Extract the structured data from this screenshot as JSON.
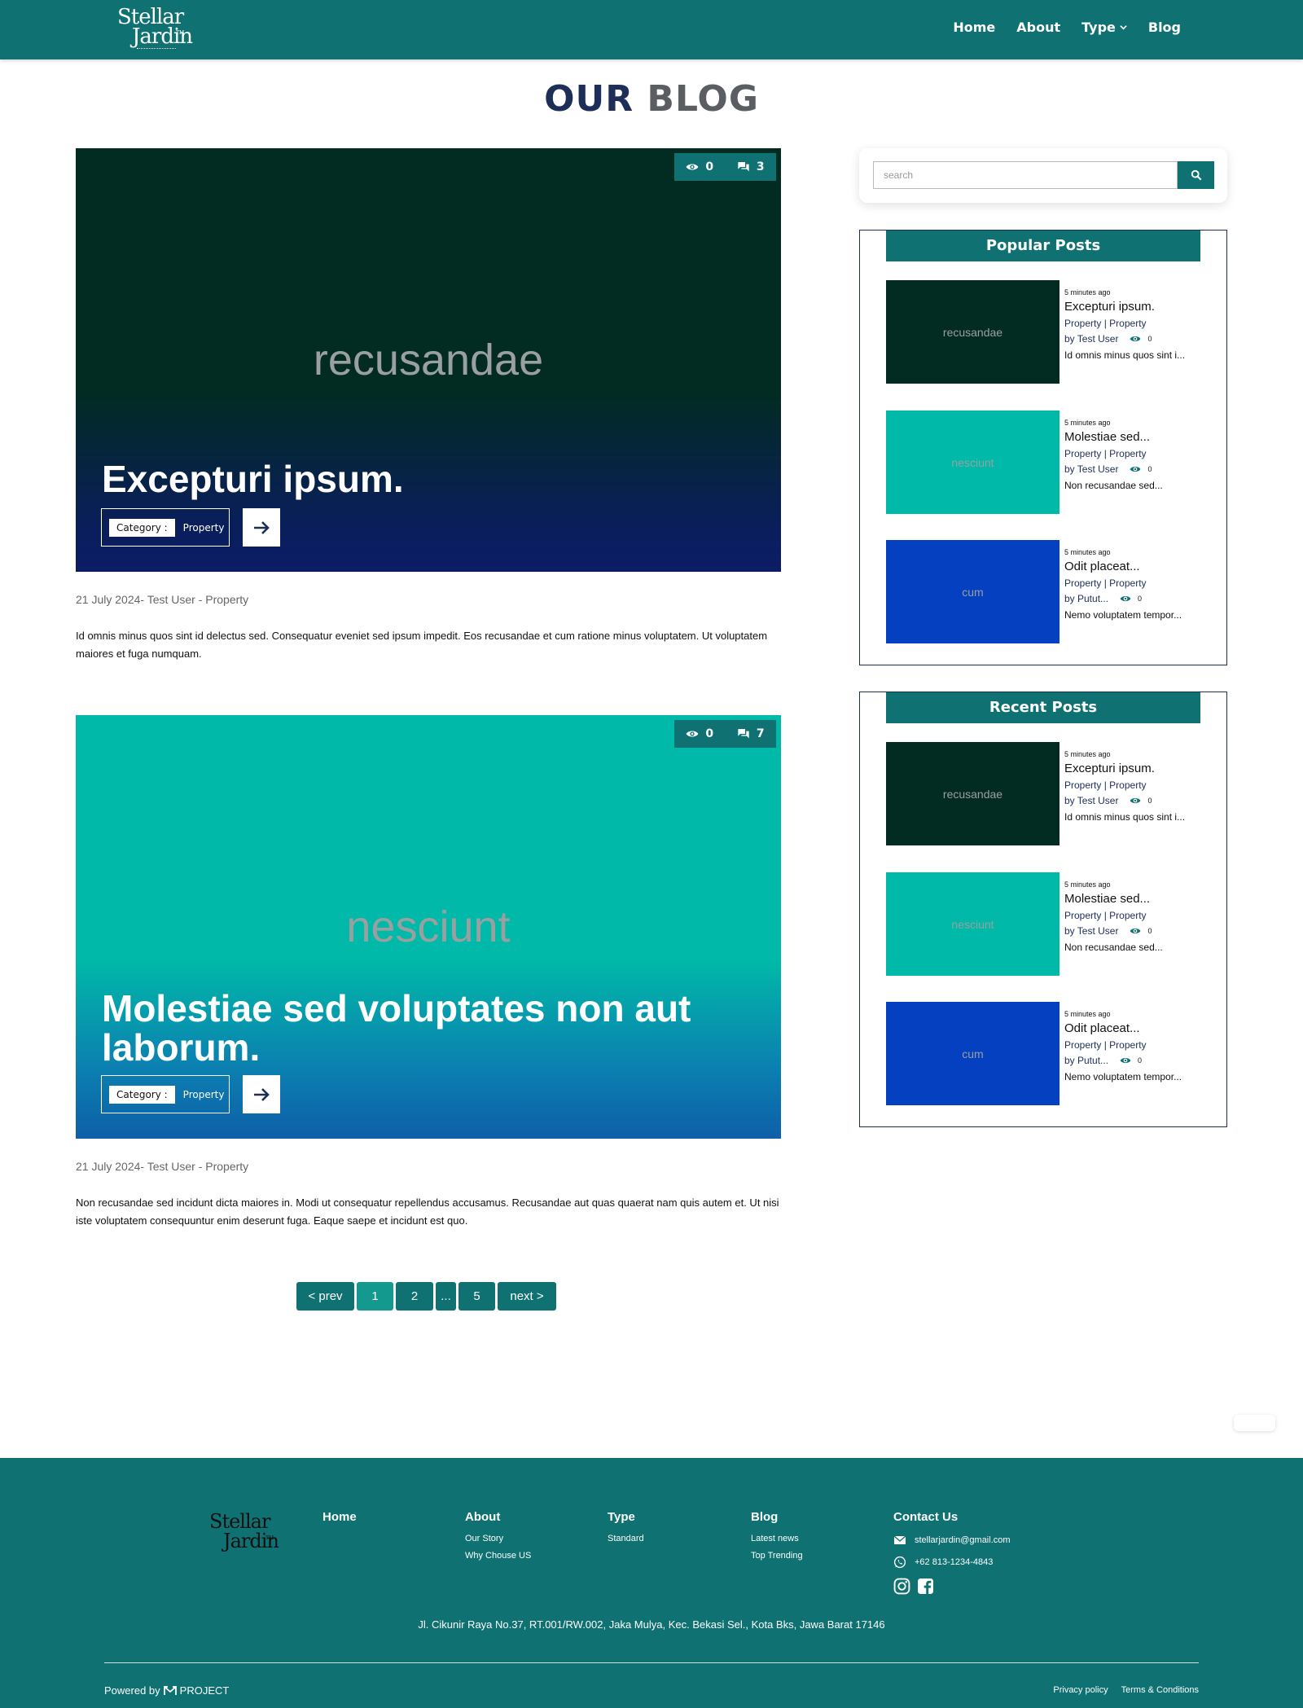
{
  "brand": {
    "logo_line1": "Stellar",
    "logo_line2": "Jardin",
    "logo_mark": "TM"
  },
  "nav": {
    "home": "Home",
    "about": "About",
    "type": "Type",
    "blog": "Blog"
  },
  "page": {
    "title_part1": "OUR",
    "title_part2": "BLOG"
  },
  "posts": [
    {
      "image_label": "recusandae",
      "image_color": "#022b22",
      "views": "0",
      "comments": "3",
      "title": "Excepturi ipsum.",
      "category_label": "Category :",
      "category": "Property",
      "meta": "21 July 2024- Test User - Property",
      "excerpt": "Id omnis minus quos sint id delectus sed. Consequatur eveniet sed ipsum impedit. Eos recusandae et cum ratione minus voluptatem. Ut voluptatem maiores et fuga numquam."
    },
    {
      "image_label": "nesciunt",
      "image_color": "#00b9a8",
      "views": "0",
      "comments": "7",
      "title": "Molestiae sed voluptates non aut laborum.",
      "category_label": "Category :",
      "category": "Property",
      "meta": "21 July 2024- Test User - Property",
      "excerpt": "Non recusandae sed incidunt dicta maiores in. Modi ut consequatur repellendus accusamus. Recusandae aut quas quaerat nam quis autem et. Ut nisi iste voluptatem consequuntur enim deserunt fuga. Eaque saepe et incidunt est quo."
    }
  ],
  "pagination": {
    "prev": "< prev",
    "p1": "1",
    "p2": "2",
    "ellipsis": "...",
    "p5": "5",
    "next": "next >"
  },
  "search": {
    "placeholder": "search"
  },
  "popular": {
    "title": "Popular Posts",
    "items": [
      {
        "image_label": "recusandae",
        "color": "#022b22",
        "ago": "5 minutes ago",
        "title": "Excepturi ipsum.",
        "cat1": "Property",
        "sep": "|",
        "cat2": "Property",
        "by": "by Test User",
        "views": "0",
        "excerpt": "Id omnis minus quos sint i..."
      },
      {
        "image_label": "nesciunt",
        "color": "#00b9a8",
        "ago": "5 minutes ago",
        "title": "Molestiae sed...",
        "cat1": "Property",
        "sep": "|",
        "cat2": "Property",
        "by": "by Test User",
        "views": "0",
        "excerpt": "Non recusandae sed..."
      },
      {
        "image_label": "cum",
        "color": "#0440bf",
        "ago": "5 minutes ago",
        "title": "Odit placeat...",
        "cat1": "Property",
        "sep": "|",
        "cat2": "Property",
        "by": "by Putut...",
        "views": "0",
        "excerpt": "Nemo voluptatem tempor..."
      }
    ]
  },
  "recent": {
    "title": "Recent Posts",
    "items": [
      {
        "image_label": "recusandae",
        "color": "#022b22",
        "ago": "5 minutes ago",
        "title": "Excepturi ipsum.",
        "cat1": "Property",
        "sep": "|",
        "cat2": "Property",
        "by": "by Test User",
        "views": "0",
        "excerpt": "Id omnis minus quos sint i..."
      },
      {
        "image_label": "nesciunt",
        "color": "#00b9a8",
        "ago": "5 minutes ago",
        "title": "Molestiae sed...",
        "cat1": "Property",
        "sep": "|",
        "cat2": "Property",
        "by": "by Test User",
        "views": "0",
        "excerpt": "Non recusandae sed..."
      },
      {
        "image_label": "cum",
        "color": "#0440bf",
        "ago": "5 minutes ago",
        "title": "Odit placeat...",
        "cat1": "Property",
        "sep": "|",
        "cat2": "Property",
        "by": "by Putut...",
        "views": "0",
        "excerpt": "Nemo voluptatem tempor..."
      }
    ]
  },
  "footer": {
    "home": "Home",
    "about": "About",
    "about_links": [
      "Our Story",
      "Why Chouse US"
    ],
    "type": "Type",
    "type_links": [
      "Standard"
    ],
    "blog": "Blog",
    "blog_links": [
      "Latest news",
      "Top Trending"
    ],
    "contact": "Contact Us",
    "email": "stellarjardin@gmail.com",
    "phone": "+62 813-1234-4843",
    "address": "Jl. Cikunir Raya No.37, RT.001/RW.002, Jaka Mulya, Kec. Bekasi Sel., Kota Bks, Jawa Barat 17146",
    "powered_by": "Powered by",
    "powered_brand": "PROJECT",
    "privacy": "Privacy policy",
    "terms": "Terms & Conditions"
  },
  "colors": {
    "primary": "#0f7172",
    "navy": "#1e2f57",
    "grey_title": "#5a5d61"
  },
  "icons": [
    "eye-icon",
    "comment-icon",
    "arrow-right-icon",
    "search-icon",
    "chevron-down-icon",
    "mail-icon",
    "whatsapp-icon",
    "instagram-icon",
    "facebook-icon"
  ]
}
